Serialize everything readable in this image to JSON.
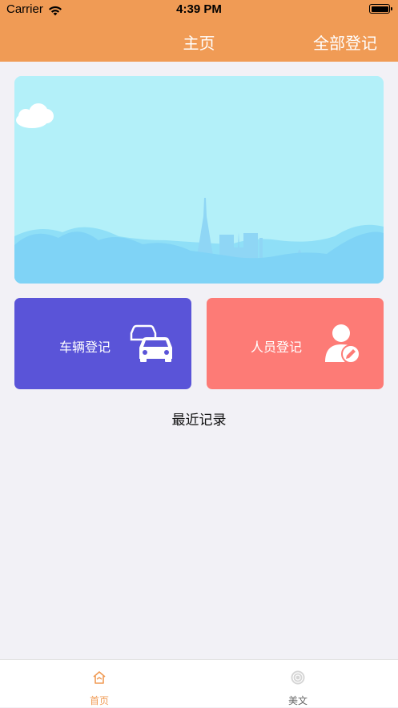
{
  "status_bar": {
    "carrier": "Carrier",
    "time": "4:39 PM"
  },
  "nav": {
    "title": "主页",
    "right_action": "全部登记"
  },
  "banner": {
    "image": "paris-skyline-illustration"
  },
  "cards": [
    {
      "label": "车辆登记",
      "icon": "cars-icon",
      "color": "#5a54d8"
    },
    {
      "label": "人员登记",
      "icon": "person-edit-icon",
      "color": "#fd7b76"
    }
  ],
  "section": {
    "title": "最近记录"
  },
  "tabs": [
    {
      "label": "首页",
      "icon": "home-icon",
      "active": true
    },
    {
      "label": "美文",
      "icon": "target-icon",
      "active": false
    }
  ],
  "colors": {
    "header": "#f09b55",
    "accent": "#f09b55",
    "background": "#f2f1f6"
  }
}
